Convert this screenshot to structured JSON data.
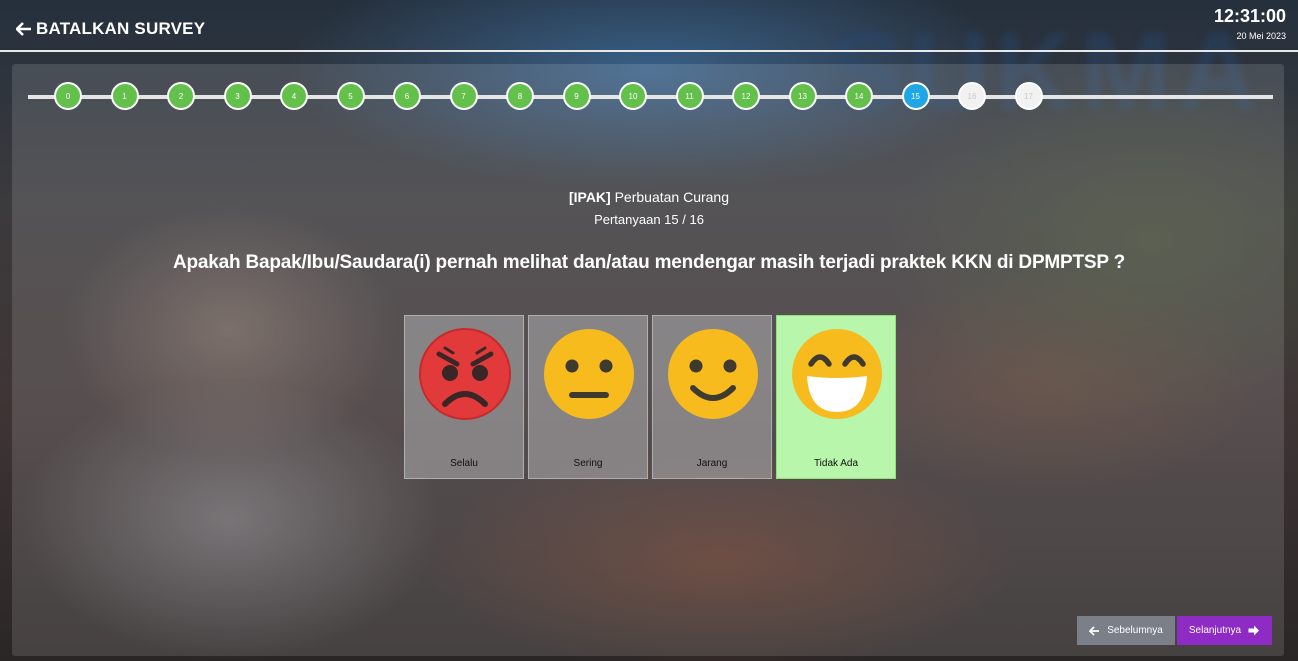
{
  "header": {
    "cancel_label": "BATALKAN SURVEY",
    "time": "12:31:00",
    "date": "20 Mei 2023"
  },
  "background": {
    "banner_text": "SUKMA"
  },
  "progress": {
    "steps": [
      "0",
      "1",
      "2",
      "3",
      "4",
      "5",
      "6",
      "7",
      "8",
      "9",
      "10",
      "11",
      "12",
      "13",
      "14",
      "15",
      "16",
      "17"
    ],
    "current_index": 15,
    "colors": {
      "done": "#63c04a",
      "current": "#1fa6e5",
      "todo": "#f2f2f2"
    }
  },
  "question": {
    "category_tag": "[IPAK]",
    "category_name": "Perbuatan Curang",
    "counter": "Pertanyaan 15 / 16",
    "text": "Apakah Bapak/Ibu/Saudara(i) pernah melihat dan/atau mendengar masih terjadi praktek KKN di DPMPTSP ?"
  },
  "options": [
    {
      "label": "Selalu",
      "icon": "angry-face-icon",
      "selected": false
    },
    {
      "label": "Sering",
      "icon": "neutral-face-icon",
      "selected": false
    },
    {
      "label": "Jarang",
      "icon": "smiling-face-icon",
      "selected": false
    },
    {
      "label": "Tidak Ada",
      "icon": "grinning-face-icon",
      "selected": true
    }
  ],
  "nav": {
    "prev_label": "Sebelumnya",
    "next_label": "Selanjutnya",
    "next_color": "#8d2bc4",
    "prev_color": "#7b7f88",
    "selected_color": "#b8f6ac"
  }
}
